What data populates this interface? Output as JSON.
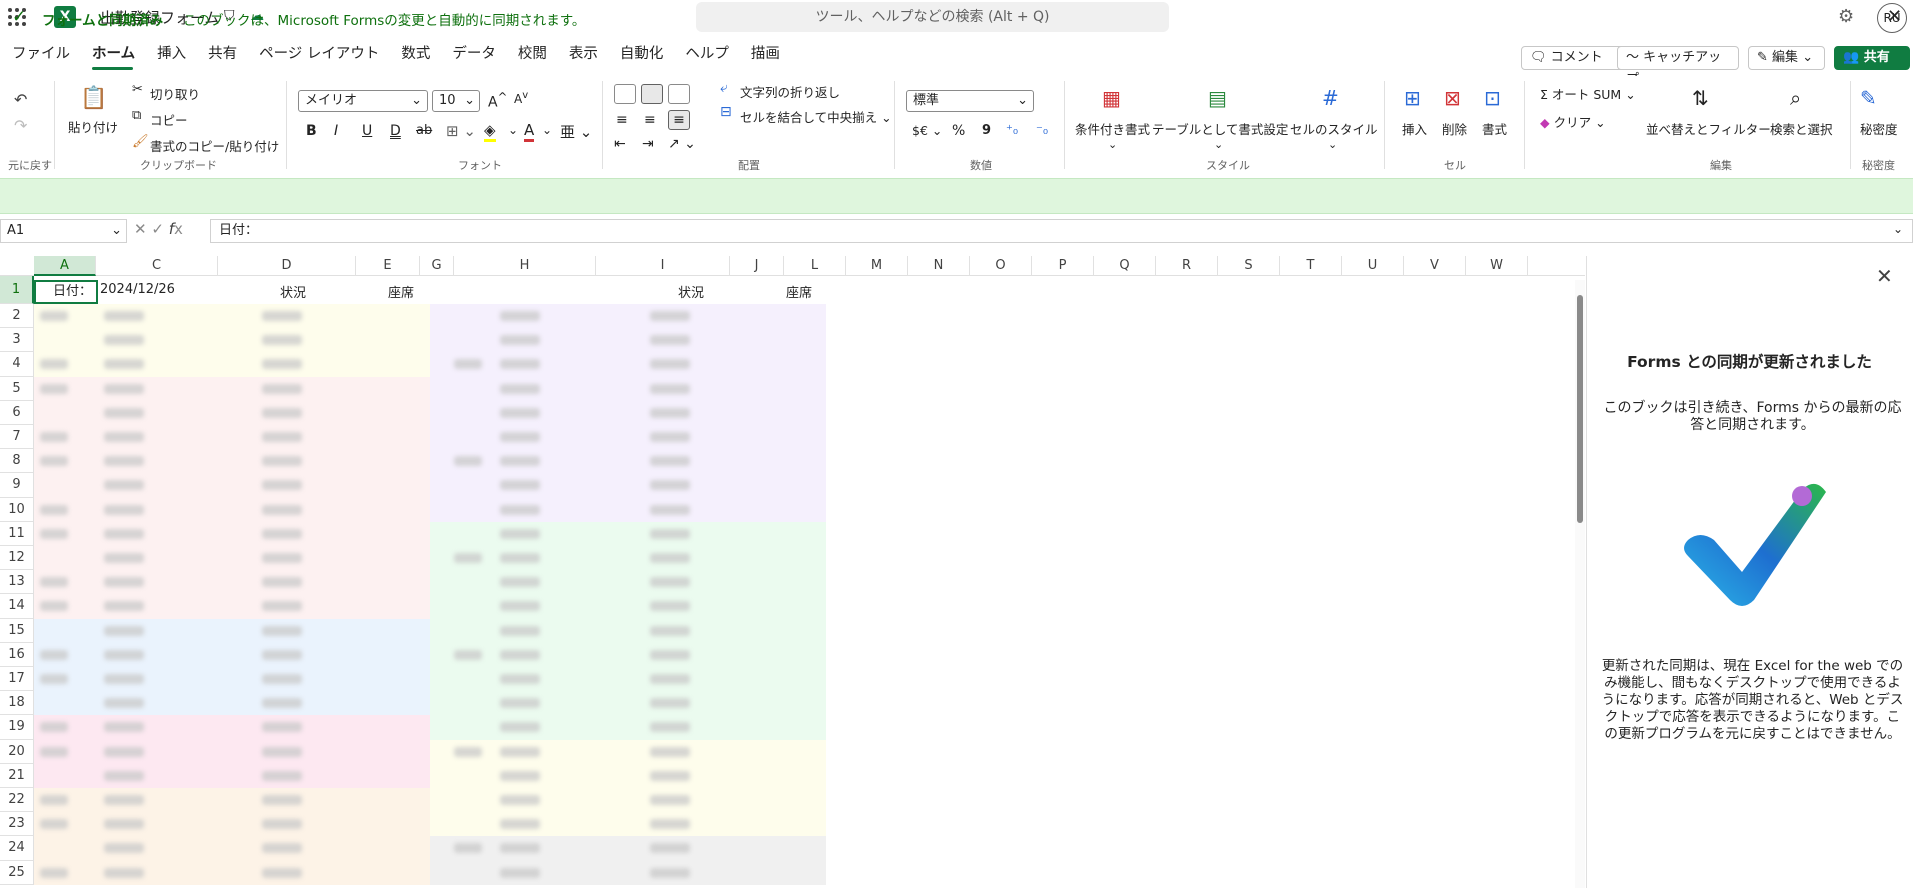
{
  "app": {
    "doc_title": "出勤登録フォーム",
    "search_placeholder": "ツール、ヘルプなどの検索 (Alt + Q)",
    "avatar_initials": "RU",
    "app_letter": "X"
  },
  "menu": {
    "tabs": [
      "ファイル",
      "ホーム",
      "挿入",
      "共有",
      "ページ レイアウト",
      "数式",
      "データ",
      "校閲",
      "表示",
      "自動化",
      "ヘルプ",
      "描画"
    ],
    "active_tab": "ホーム",
    "comment_label": "コメント",
    "catchup_label": "キャッチアップ",
    "edit_label": "編集",
    "share_label": "共有"
  },
  "ribbon": {
    "undo_group": "元に戻す",
    "paste": "貼り付け",
    "cut": "切り取り",
    "copy": "コピー",
    "format_painter": "書式のコピー/貼り付け",
    "clipboard_group": "クリップボード",
    "font_name": "メイリオ",
    "font_size": "10",
    "bold": "B",
    "italic": "I",
    "underline": "U",
    "double_underline": "D",
    "strike": "ab",
    "font_group": "フォント",
    "wrap_text": "文字列の折り返し",
    "merge_center": "セルを結合して中央揃え",
    "alignment_group": "配置",
    "number_format": "標準",
    "number_group": "数値",
    "currency": "$€",
    "percent": "%",
    "comma": "9",
    "conditional": "条件付き書式",
    "format_table": "テーブルとして書式設定",
    "cell_styles": "セルのスタイル",
    "styles_group": "スタイル",
    "insert": "挿入",
    "delete": "削除",
    "format": "書式",
    "cells_group": "セル",
    "autosum": "オート SUM",
    "clear": "クリア",
    "sort_filter": "並べ替えとフィルター",
    "find_select": "検索と選択",
    "editing_group": "編集",
    "sensitivity": "秘密度",
    "sensitivity_group": "秘密度"
  },
  "banner": {
    "title": "フォームと同期済み",
    "text": "このブックは、Microsoft Formsの変更と自動的に同期されます。"
  },
  "formula_bar": {
    "name_box": "A1",
    "content": "日付："
  },
  "sheet": {
    "columns": [
      "A",
      "C",
      "D",
      "E",
      "G",
      "H",
      "I",
      "J",
      "L",
      "M",
      "N",
      "O",
      "P",
      "Q",
      "R",
      "S",
      "T",
      "U",
      "V",
      "W"
    ],
    "selected_column": "A",
    "rows": [
      "1",
      "2",
      "3",
      "4",
      "5",
      "6",
      "7",
      "8",
      "9",
      "10",
      "11",
      "12",
      "13",
      "14",
      "15",
      "16",
      "17",
      "18",
      "19",
      "20",
      "21",
      "22",
      "23",
      "24",
      "25"
    ],
    "selected_row": "1",
    "a1": "日付：",
    "c1": "2024/12/26",
    "d1": "状況",
    "e1": "座席",
    "i1": "状況",
    "j1": "座席"
  },
  "pane": {
    "title": "Forms との同期が更新されました",
    "subtitle": "このブックは引き続き、Forms からの最新の応答と同期されます。",
    "body": "更新された同期は、現在 Excel for the web でのみ機能し、間もなくデスクトップで使用できるようになります。応答が同期されると、Web とデスクトップで応答を表示できるようになります。この更新プログラムを元に戻すことはできません。"
  },
  "colors": {
    "accent": "#107c41",
    "banner_bg": "#dff6dd",
    "yellow_band": "#fefdec",
    "pink_band": "#fdf1f1",
    "blue_band": "#eaf3fd",
    "rose_band": "#fde8f1",
    "orange_band": "#fdf3e7",
    "lavender_band": "#f5f0fd",
    "mint_band": "#ebfbef",
    "gray_band": "#f0f0f0"
  },
  "icons": [
    "waffle-icon",
    "excel-logo-icon",
    "shield-icon",
    "cloud-sync-icon",
    "gear-icon",
    "comment-icon",
    "catchup-icon",
    "pencil-icon",
    "share-icon",
    "undo-icon",
    "redo-icon",
    "paste-icon",
    "cut-icon",
    "copy-icon",
    "format-painter-icon",
    "check-circle-icon",
    "close-icon",
    "checkmark-illustration"
  ]
}
